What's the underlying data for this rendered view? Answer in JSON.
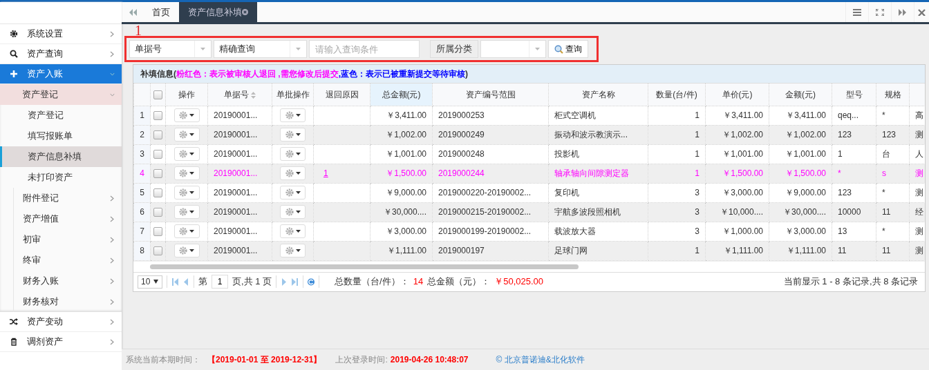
{
  "tabs": [
    {
      "label": "首页",
      "selected": false,
      "closable": false
    },
    {
      "label": "资产信息补填",
      "selected": true,
      "closable": true
    }
  ],
  "sidebar": {
    "items": [
      {
        "label": "系统设置",
        "expanded": false,
        "selected": false
      },
      {
        "label": "资产查询",
        "expanded": false,
        "selected": false
      },
      {
        "label": "资产入账",
        "expanded": true,
        "selected": false,
        "children": [
          {
            "label": "资产登记",
            "expanded": true,
            "selected": false,
            "children": [
              {
                "label": "资产登记",
                "selected": false
              },
              {
                "label": "填写报账单",
                "selected": false
              },
              {
                "label": "资产信息补填",
                "selected": true
              },
              {
                "label": "未打印资产",
                "selected": false
              }
            ]
          },
          {
            "label": "附件登记",
            "expanded": false,
            "selected": false
          },
          {
            "label": "资产增值",
            "expanded": false,
            "selected": false
          },
          {
            "label": "初审",
            "expanded": false,
            "selected": false
          },
          {
            "label": "终审",
            "expanded": false,
            "selected": false
          },
          {
            "label": "财务入账",
            "expanded": false,
            "selected": false
          },
          {
            "label": "财务核对",
            "expanded": false,
            "selected": false
          }
        ]
      },
      {
        "label": "资产变动",
        "expanded": false,
        "selected": false
      },
      {
        "label": "调剂资产",
        "expanded": false,
        "selected": false
      }
    ]
  },
  "annotation": {
    "label": "1"
  },
  "search": {
    "field": "单据号",
    "mode": "精确查询",
    "placeholder": "请输入查询条件",
    "category_label": "所属分类",
    "button": "查询"
  },
  "table": {
    "legend": [
      {
        "text": "补填信息(",
        "color": "#333333"
      },
      {
        "text": "粉红色：表示被审核人退回 ,需您修改后提交",
        "color": "#ff00ff"
      },
      {
        "text": ",蓝色：表示已被重新提交等待审核",
        "color": "#0000ff"
      },
      {
        "text": ")",
        "color": "#333333"
      }
    ],
    "select_all": {
      "checked": false
    },
    "columns": [
      {
        "label": "操作",
        "kind": "action"
      },
      {
        "label": "单据号",
        "kind": "text",
        "sortable": true
      },
      {
        "label": "单批操作",
        "kind": "action"
      },
      {
        "label": "退回原因",
        "kind": "reason"
      },
      {
        "label": "总金额(元)",
        "kind": "number",
        "highlighted": true
      },
      {
        "label": "资产编号范围",
        "kind": "text"
      },
      {
        "label": "资产名称",
        "kind": "text"
      },
      {
        "label": "数量(台/件)",
        "kind": "number"
      },
      {
        "label": "单价(元)",
        "kind": "number"
      },
      {
        "label": "金额(元)",
        "kind": "number"
      },
      {
        "label": "型号",
        "kind": "text"
      },
      {
        "label": "规格",
        "kind": "text"
      },
      {
        "kind": "text"
      }
    ],
    "rows": [
      {
        "no": "1",
        "checked": false,
        "returned": false,
        "bill_no": "20190001...",
        "total": "￥3,411.00",
        "code_range": "2019000253",
        "name": "柜式空调机",
        "qty": "1",
        "unit_price": "￥3,411.00",
        "amount": "￥3,411.00",
        "model": "qeq...",
        "spec": "*",
        "column_15": "高"
      },
      {
        "no": "2",
        "checked": false,
        "returned": false,
        "bill_no": "20190001...",
        "total": "￥1,002.00",
        "code_range": "2019000249",
        "name": "振动和波示教演示...",
        "qty": "1",
        "unit_price": "￥1,002.00",
        "amount": "￥1,002.00",
        "model": "123",
        "spec": "123",
        "column_15": "测"
      },
      {
        "no": "3",
        "checked": false,
        "returned": false,
        "bill_no": "20190001...",
        "total": "￥1,001.00",
        "code_range": "2019000248",
        "name": "投影机",
        "qty": "1",
        "unit_price": "￥1,001.00",
        "amount": "￥1,001.00",
        "model": "1",
        "spec": "台",
        "column_15": "人"
      },
      {
        "no": "4",
        "checked": false,
        "returned": true,
        "bill_no": "20190001...",
        "return_reason": "1",
        "total": "￥1,500.00",
        "code_range": "2019000244",
        "name": "轴承轴向间隙测定器",
        "qty": "1",
        "unit_price": "￥1,500.00",
        "amount": "￥1,500.00",
        "model": "*",
        "spec": "s",
        "column_15": "测"
      },
      {
        "no": "5",
        "checked": false,
        "returned": false,
        "bill_no": "20190001...",
        "total": "￥9,000.00",
        "code_range": "2019000220-20190002...",
        "name": "复印机",
        "qty": "3",
        "unit_price": "￥3,000.00",
        "amount": "￥9,000.00",
        "model": "123",
        "spec": "*",
        "column_15": "测"
      },
      {
        "no": "6",
        "checked": false,
        "returned": false,
        "bill_no": "20190001...",
        "total": "￥30,000....",
        "code_range": "2019000215-20190002...",
        "name": "宇航多波段照相机",
        "qty": "3",
        "unit_price": "￥10,000....",
        "amount": "￥30,000....",
        "model": "10000",
        "spec": "11",
        "column_15": "经"
      },
      {
        "no": "7",
        "checked": false,
        "returned": false,
        "bill_no": "20190001...",
        "total": "￥3,000.00",
        "code_range": "2019000199-20190002...",
        "name": "载波放大器",
        "qty": "3",
        "unit_price": "￥1,000.00",
        "amount": "￥3,000.00",
        "model": "13",
        "spec": "*",
        "column_15": "测"
      },
      {
        "no": "8",
        "checked": false,
        "returned": false,
        "bill_no": "20190001...",
        "total": "￥1,111.00",
        "code_range": "2019000197",
        "name": "足球门网",
        "qty": "1",
        "unit_price": "￥1,111.00",
        "amount": "￥1,111.00",
        "model": "11",
        "spec": "11",
        "column_15": "测"
      }
    ]
  },
  "pager": {
    "page_size": "10",
    "page_prefix": "第",
    "page": "1",
    "page_suffix": "页,共 1 页",
    "qty_label": "总数量（台/件）：",
    "qty": "14",
    "total_label": "总金额（元）：",
    "total": "￥50,025.00",
    "summary": "当前显示 1 - 8 条记录,共 8 条记录"
  },
  "status_bar": {
    "period_label": "系统当前本期时间：",
    "period": "【2019-01-01 至 2019-12-31】",
    "login_label": "上次登录时间:",
    "login": "2019-04-26 10:48:07",
    "copyright": "© 北京普诺迪&北化软件"
  }
}
